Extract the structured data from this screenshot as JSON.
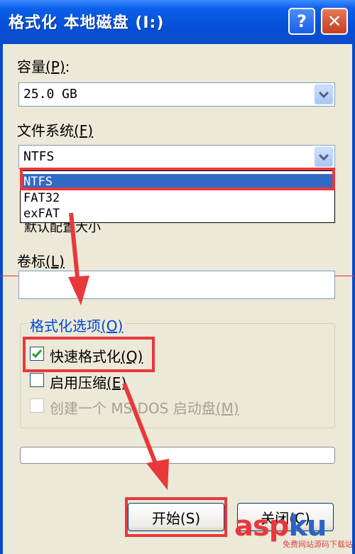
{
  "window": {
    "title": "格式化 本地磁盘 (I:)",
    "help_glyph": "?",
    "close_glyph": "✕"
  },
  "capacity": {
    "label_prefix": "容量",
    "label_key": "(P)",
    "label_suffix": ":",
    "value": "25.0 GB"
  },
  "filesystem": {
    "label_prefix": "文件系统",
    "label_key": "(F)",
    "value": "NTFS",
    "options": [
      "NTFS",
      "FAT32",
      "exFAT"
    ],
    "selected": "NTFS"
  },
  "alloc_partial_text": "默认配置大小",
  "volume": {
    "label_prefix": "卷标",
    "label_key": "(L)",
    "value": ""
  },
  "format_options": {
    "title_prefix": "格式化选项",
    "title_key": "(O)",
    "quick": {
      "label": "快速格式化",
      "key": "(Q)",
      "checked": true
    },
    "compress": {
      "label": "启用压缩",
      "key": "(E)",
      "checked": false
    },
    "msdos": {
      "label": "创建一个 MS-DOS 启动盘",
      "key": "(M)",
      "checked": false,
      "disabled": true
    }
  },
  "buttons": {
    "start": "开始(S)",
    "close": "关闭(C)"
  },
  "watermark": {
    "part1": "asp",
    "part2": "ku",
    "tag": "免费网站源码下载站"
  },
  "colors": {
    "highlight": "#e8383c",
    "titlebar": "#0a5fe8",
    "selection": "#316ac5"
  }
}
